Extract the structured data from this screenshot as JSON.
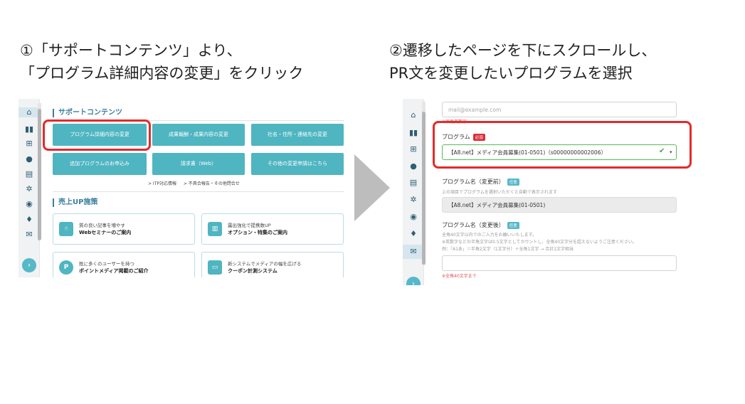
{
  "step1": {
    "title_line1": "①「サポートコンテンツ」より、",
    "title_line2": "「プログラム詳細内容の変更」をクリック"
  },
  "step2": {
    "title_line1": "②遷移したページを下にスクロールし、",
    "title_line2": "PR文を変更したいプログラムを選択"
  },
  "screen1": {
    "support_title": "サポートコンテンツ",
    "buttons": [
      "プログラム詳細内容の変更",
      "成果報酬・成果内容の変更",
      "社名・住所・連絡先の変更",
      "追加プログラムのお申込み",
      "請求書（Web）",
      "その他の変更申請はこちら"
    ],
    "links": [
      "> ITP対応情報",
      "> 不具合報告・その他問合せ"
    ],
    "sales_title": "売上UP施策",
    "cards": [
      {
        "line1": "質の良い記事を増やす",
        "line2": "Webセミナーのご案内"
      },
      {
        "line1": "露出強化で提携数UP",
        "line2": "オプション・特集のご案内"
      },
      {
        "line1": "既に多くのユーザーを持つ",
        "line2": "ポイントメディア掲載のご紹介"
      },
      {
        "line1": "新システムでメディアの幅を広げる",
        "line2": "クーポン計測システム"
      }
    ]
  },
  "screen2": {
    "email_placeholder": "mail@example.com",
    "email_note": "※半角英数字",
    "program_label": "プログラム",
    "required_badge": "必須",
    "program_value": "【A8.net】メディア会員募集(01-0501)（s00000000002006）",
    "before_label": "プログラム名（変更前）",
    "before_badge": "任意",
    "before_note": "上の項目でプログラムを選択いただくと自動で表示されます",
    "before_value": "【A8.net】メディア会員募集(01-0501)",
    "after_label": "プログラム名（変更後）",
    "after_badge": "任意",
    "after_notes": [
      "全角40文字以内でのご入力をお願いいたします。",
      "※英数字などの半角文字は0.5文字としてカウントし、全角40文字分を超えないようご注意ください。",
      "例：「A1あ」＝半角2文字（1文字分）＋全角1文字 → 合計2文字相当"
    ],
    "after_error": "※全角40文字まで"
  },
  "colors": {
    "accent": "#4fb5c1",
    "highlight": "#e22b2b",
    "section": "#3a7ea1"
  }
}
